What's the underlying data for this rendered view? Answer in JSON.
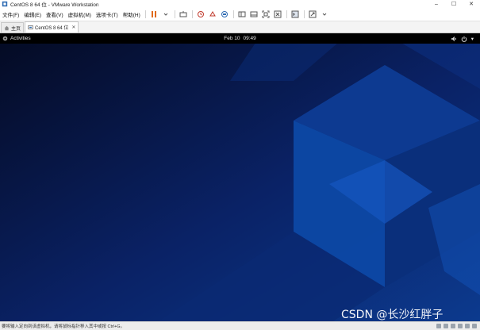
{
  "window": {
    "title": "CentOS 8 64 位 - VMware Workstation",
    "minimize": "–",
    "maximize": "☐",
    "close": "✕"
  },
  "menu": {
    "items": [
      "文件(F)",
      "编辑(E)",
      "查看(V)",
      "虚拟机(M)",
      "选项卡(T)",
      "帮助(H)"
    ]
  },
  "tabs": [
    {
      "label": "主页"
    },
    {
      "label": "CentOS 8 64 位",
      "close": "✕"
    }
  ],
  "guest": {
    "activities": "Activities",
    "date": "Feb 10",
    "time": "09:49",
    "menu_arrow": "▾"
  },
  "statusbar": {
    "text": "要将输入定向到该虚拟机，请将鼠标指针移入其中或按 Ctrl+G。"
  },
  "watermark": "CSDN @长沙红胖子",
  "colors": {
    "wallpaper_dark": "#040c2a",
    "wallpaper_blue": "#0d3f9a",
    "pause_orange": "#e06a1c"
  }
}
